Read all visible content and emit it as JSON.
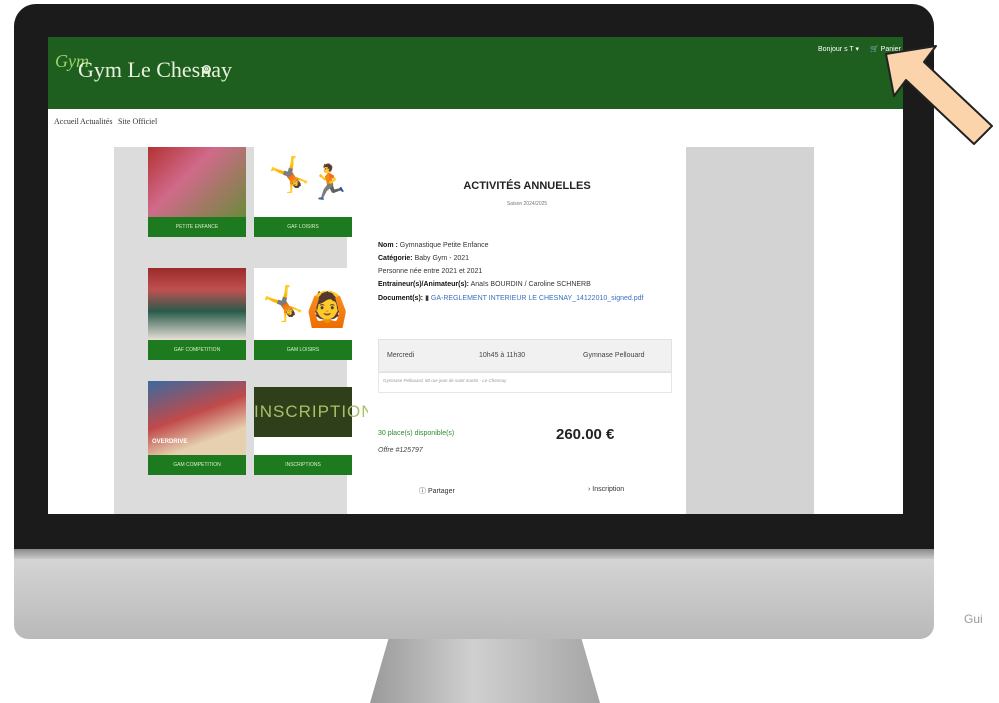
{
  "header": {
    "logo_mark": "Gym",
    "brand": "Gym Le Chesnay",
    "greeting": "Bonjour s T ▾",
    "cart": "🛒 Panier"
  },
  "nav": {
    "items": [
      "Accueil",
      "Actualités",
      "Site Officiel"
    ]
  },
  "cards": [
    {
      "label": "PETITE ENFANCE"
    },
    {
      "label": "GAF LOISIRS"
    },
    {
      "label": "GAF COMPETITION"
    },
    {
      "label": "GAM LOISIRS"
    },
    {
      "label": "GAM COMPETITION",
      "badge": "OVERDRIVE"
    },
    {
      "label": "INSCRIPTIONS",
      "image_text": "INSCRIPTION"
    }
  ],
  "detail": {
    "title": "ACTIVITÉS ANNUELLES",
    "season": "Saison 2024/2025",
    "name_label": "Nom :",
    "name_value": "Gymnastique Petite Enfance",
    "category_label": "Catégorie:",
    "category_value": "Baby Gym - 2021",
    "persons": "Personne née entre 2021 et 2021",
    "trainers_label": "Entraineur(s)/Animateur(s):",
    "trainers_value": "Anaïs BOURDIN / Caroline SCHNERB",
    "docs_label": "Document(s):",
    "doc_link": "GA-REGLEMENT INTERIEUR LE CHESNAY_14122010_signed.pdf",
    "schedule": {
      "day": "Mercredi",
      "time": "10h45 à 11h30",
      "place": "Gymnase Pellouard"
    },
    "address": "Gymnase Pellouard, 60 rue jean de saint martin - Le Chesnay",
    "places": "30 place(s) disponible(s)",
    "offer": "Offre #125797",
    "price": "260.00 €",
    "share": "Partager",
    "inscription": "Inscription"
  },
  "caption": "Gui"
}
